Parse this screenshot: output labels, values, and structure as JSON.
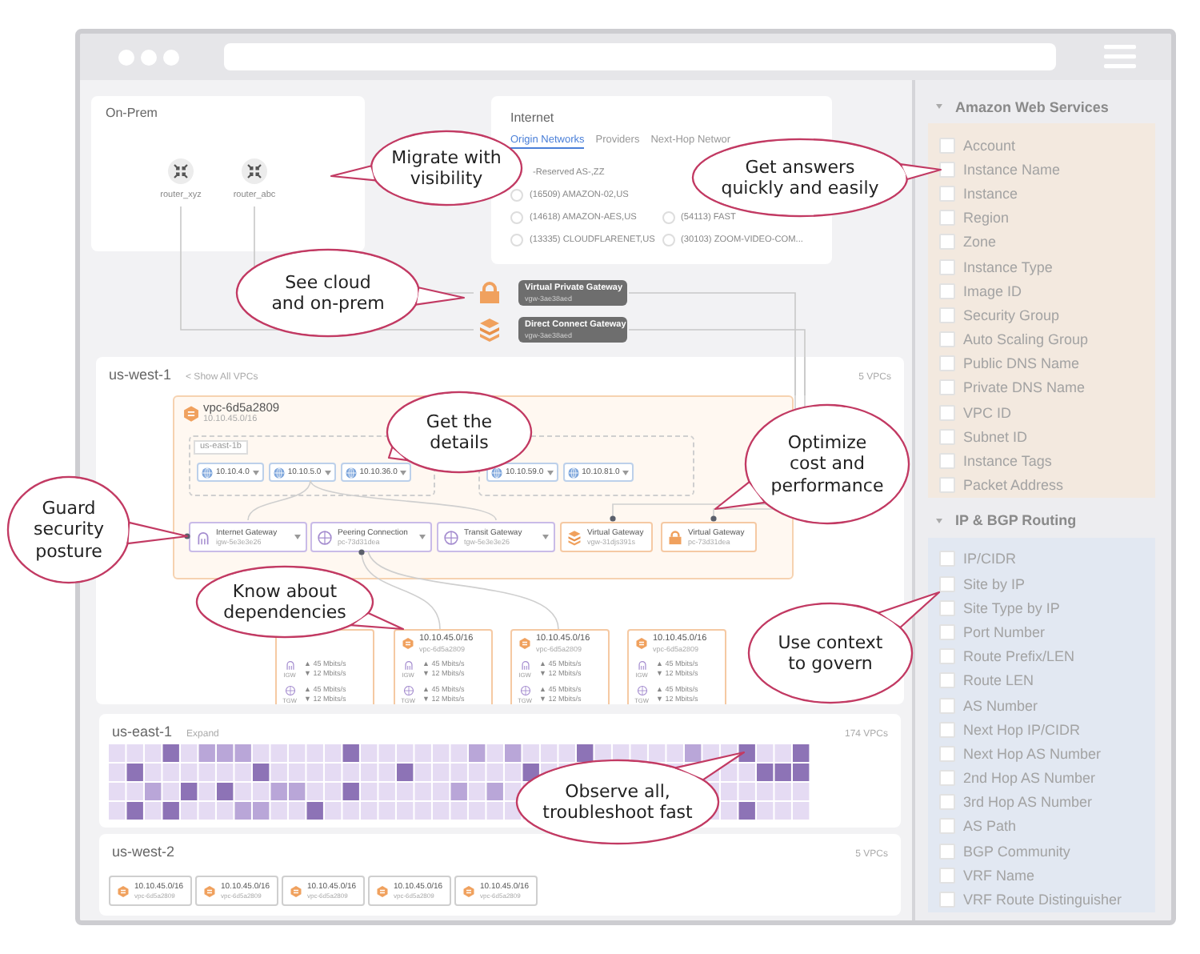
{
  "on_prem": {
    "title": "On-Prem",
    "routers": [
      {
        "name": "router_xyz"
      },
      {
        "name": "router_abc"
      }
    ]
  },
  "internet": {
    "title": "Internet",
    "tabs": [
      {
        "label": "Origin Networks",
        "selected": true
      },
      {
        "label": "Providers",
        "selected": false
      },
      {
        "label": "Next-Hop Networ",
        "selected": false
      }
    ],
    "columns": [
      {
        "items": [
          {
            "kind": "cut",
            "label": "-Reserved AS-,ZZ"
          },
          {
            "kind": "option",
            "label": "(16509) AMAZON-02,US",
            "selected": false
          },
          {
            "kind": "option",
            "label": "(14618) AMAZON-AES,US",
            "selected": false
          },
          {
            "kind": "option",
            "label": "(13335) CLOUDFLARENET,US",
            "selected": false
          }
        ]
      },
      {
        "items": [
          {
            "kind": "option",
            "label": "(54113) FAST",
            "selected": false
          },
          {
            "kind": "option",
            "label": "(30103) ZOOM-VIDEO-COM...",
            "selected": false
          }
        ]
      }
    ]
  },
  "gateways": [
    {
      "kind": "virtual_private",
      "name": "Virtual Private Gateway",
      "id": "vgw-3ae38aed"
    },
    {
      "kind": "direct_connect",
      "name": "Direct Connect Gateway",
      "id": "vgw-3ae38aed"
    }
  ],
  "regions": [
    {
      "kind": "detail",
      "name": "us-west-1",
      "link": "< Show All VPCs",
      "count": "5 VPCs",
      "vpc": {
        "name": "vpc-6d5a2809",
        "cidr": "10.10.45.0/16",
        "zones": [
          {
            "label": "us-east-1b",
            "subnets": [
              "10.10.4.0",
              "10.10.5.0",
              "10.10.36.0"
            ]
          },
          {
            "subnets": [
              "10.10.59.0",
              "10.10.81.0"
            ]
          }
        ],
        "gateways": [
          {
            "kind": "internet",
            "name": "Internet Gateway",
            "id": "igw-5e3e3e26",
            "dropdown": true
          },
          {
            "kind": "peering",
            "name": "Peering Connection",
            "id": "pc-73d31dea",
            "dropdown": true
          },
          {
            "kind": "transit",
            "name": "Transit Gateway",
            "id": "tgw-5e3e3e26",
            "dropdown": true
          },
          {
            "kind": "virtual",
            "name": "Virtual Gateway",
            "id": "vgw-31djs391s",
            "dropdown": false
          },
          {
            "kind": "virtual_private",
            "name": "Virtual Gateway",
            "id": "pc-73d31dea",
            "dropdown": false
          }
        ]
      },
      "peers": [
        {
          "links": [
            {
              "kind": "igw",
              "label": "IGW",
              "up": "▲ 45 Mbits/s",
              "down": "▼ 12 Mbits/s"
            },
            {
              "kind": "tgw",
              "label": "TGW",
              "up": "▲ 45 Mbits/s",
              "down": "▼ 12 Mbits/s"
            }
          ]
        },
        {
          "cidr": "10.10.45.0/16",
          "id": "vpc-6d5a2809",
          "links": [
            {
              "kind": "igw",
              "label": "IGW",
              "up": "▲ 45 Mbits/s",
              "down": "▼ 12 Mbits/s"
            },
            {
              "kind": "tgw",
              "label": "TGW",
              "up": "▲ 45 Mbits/s",
              "down": "▼ 12 Mbits/s"
            }
          ]
        },
        {
          "cidr": "10.10.45.0/16",
          "id": "vpc-6d5a2809",
          "links": [
            {
              "kind": "igw",
              "label": "IGW",
              "up": "▲ 45 Mbits/s",
              "down": "▼ 12 Mbits/s"
            },
            {
              "kind": "tgw",
              "label": "TGW",
              "up": "▲ 45 Mbits/s",
              "down": "▼ 12 Mbits/s"
            }
          ]
        },
        {
          "cidr": "10.10.45.0/16",
          "id": "vpc-6d5a2809",
          "links": [
            {
              "kind": "igw",
              "label": "IGW",
              "up": "▲ 45 Mbits/s",
              "down": "▼ 12 Mbits/s"
            },
            {
              "kind": "tgw",
              "label": "TGW",
              "up": "▲ 45 Mbits/s",
              "down": "▼ 12 Mbits/s"
            }
          ]
        }
      ]
    },
    {
      "kind": "heatmap",
      "name": "us-east-1",
      "link": "Expand",
      "count": "174 VPCs"
    },
    {
      "kind": "chips",
      "name": "us-west-2",
      "count": "5 VPCs",
      "chips": [
        {
          "cidr": "10.10.45.0/16",
          "id": "vpc-6d5a2809"
        },
        {
          "cidr": "10.10.45.0/16",
          "id": "vpc-6d5a2809"
        },
        {
          "cidr": "10.10.45.0/16",
          "id": "vpc-6d5a2809"
        },
        {
          "cidr": "10.10.45.0/16",
          "id": "vpc-6d5a2809"
        },
        {
          "cidr": "10.10.45.0/16",
          "id": "vpc-6d5a2809"
        }
      ]
    }
  ],
  "sidebar": {
    "groups": [
      {
        "title": "Amazon Web Services",
        "expanded": true,
        "color": "#f3e9df",
        "items": [
          {
            "label": "Account",
            "checked": false
          },
          {
            "label": "Instance Name",
            "checked": false
          },
          {
            "label": "Instance",
            "checked": false
          },
          {
            "label": "Region",
            "checked": false
          },
          {
            "label": "Zone",
            "checked": false
          },
          {
            "label": "Instance Type",
            "checked": false
          },
          {
            "label": "Image ID",
            "checked": false
          },
          {
            "label": "Security Group",
            "checked": false
          },
          {
            "label": "Auto Scaling Group",
            "checked": false
          },
          {
            "label": "Public DNS Name",
            "checked": false
          },
          {
            "label": "Private DNS Name",
            "checked": false
          },
          {
            "label": "VPC ID",
            "checked": false
          },
          {
            "label": "Subnet ID",
            "checked": false
          },
          {
            "label": "Instance Tags",
            "checked": false
          },
          {
            "label": "Packet Address",
            "checked": false
          }
        ]
      },
      {
        "title": "IP & BGP Routing",
        "expanded": true,
        "color": "#e2e8f2",
        "items": [
          {
            "label": "IP/CIDR",
            "checked": false
          },
          {
            "label": "Site by IP",
            "checked": false
          },
          {
            "label": "Site Type by IP",
            "checked": false
          },
          {
            "label": "Port Number",
            "checked": false
          },
          {
            "label": "Route Prefix/LEN",
            "checked": false
          },
          {
            "label": "Route LEN",
            "checked": false
          },
          {
            "label": "AS Number",
            "checked": false
          },
          {
            "label": "Next Hop IP/CIDR",
            "checked": false
          },
          {
            "label": "Next Hop AS Number",
            "checked": false
          },
          {
            "label": "2nd Hop AS Number",
            "checked": false
          },
          {
            "label": "3rd Hop AS Number",
            "checked": false
          },
          {
            "label": "AS Path",
            "checked": false
          },
          {
            "label": "BGP Community",
            "checked": false
          },
          {
            "label": "VRF Name",
            "checked": false
          },
          {
            "label": "VRF Route Distinguisher",
            "checked": false
          }
        ]
      }
    ]
  },
  "callouts": [
    {
      "text": "Migrate with\nvisibility"
    },
    {
      "text": "Get answers\nquickly and easily"
    },
    {
      "text": "See cloud\nand on-prem"
    },
    {
      "text": "Get the\ndetails"
    },
    {
      "text": "Optimize\ncost and\nperformance"
    },
    {
      "text": "Guard\nsecurity\nposture"
    },
    {
      "text": "Know about\ndependencies"
    },
    {
      "text": "Use context\nto govern"
    },
    {
      "text": "Observe all,\ntroubleshoot fast"
    }
  ]
}
